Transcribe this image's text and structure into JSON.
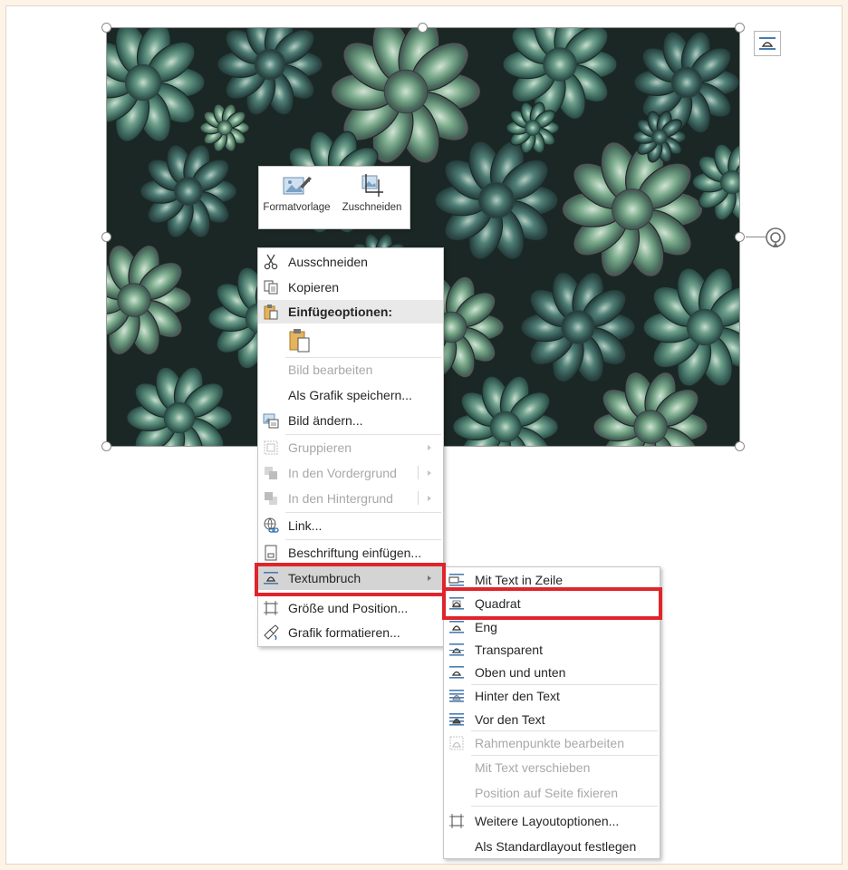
{
  "colors": {
    "highlight": "#e0242b",
    "background": "#fdf3e6"
  },
  "mini_toolbar": [
    {
      "label": "Formatvorlage",
      "icon": "style-icon"
    },
    {
      "label": "Zuschneiden",
      "icon": "crop-icon"
    }
  ],
  "context_menu": {
    "items": [
      {
        "label": "Ausschneiden",
        "icon": "scissors-icon",
        "enabled": true
      },
      {
        "label": "Kopieren",
        "icon": "copy-icon",
        "enabled": true
      },
      {
        "label": "Einfügeoptionen:",
        "icon": "paste-icon",
        "enabled": true
      },
      {
        "label": "Bild bearbeiten",
        "enabled": false
      },
      {
        "label": "Als Grafik speichern...",
        "enabled": true
      },
      {
        "label": "Bild ändern...",
        "icon": "change-picture-icon",
        "enabled": true
      },
      {
        "label": "Gruppieren",
        "icon": "group-icon",
        "enabled": false
      },
      {
        "label": "In den Vordergrund",
        "icon": "bring-forward-icon",
        "enabled": false
      },
      {
        "label": "In den Hintergrund",
        "icon": "send-backward-icon",
        "enabled": false
      },
      {
        "label": "Link...",
        "icon": "link-icon",
        "enabled": true
      },
      {
        "label": "Beschriftung einfügen...",
        "icon": "caption-icon",
        "enabled": true
      },
      {
        "label": "Textumbruch",
        "icon": "wrap-text-icon",
        "enabled": true,
        "highlighted": true
      },
      {
        "label": "Größe und Position...",
        "icon": "size-position-icon",
        "enabled": true
      },
      {
        "label": "Grafik formatieren...",
        "icon": "format-picture-icon",
        "enabled": true
      }
    ]
  },
  "wrap_submenu": {
    "items": [
      {
        "label": "Mit Text in Zeile",
        "icon": "inline-wrap-icon",
        "enabled": true
      },
      {
        "label": "Quadrat",
        "icon": "square-wrap-icon",
        "enabled": true,
        "highlighted": true
      },
      {
        "label": "Eng",
        "icon": "tight-wrap-icon",
        "enabled": true
      },
      {
        "label": "Transparent",
        "icon": "through-wrap-icon",
        "enabled": true
      },
      {
        "label": "Oben und unten",
        "icon": "top-bottom-wrap-icon",
        "enabled": true
      },
      {
        "label": "Hinter den Text",
        "icon": "behind-text-icon",
        "enabled": true
      },
      {
        "label": "Vor den Text",
        "icon": "in-front-text-icon",
        "enabled": true
      },
      {
        "label": "Rahmenpunkte bearbeiten",
        "icon": "edit-wrap-points-icon",
        "enabled": false
      },
      {
        "label": "Mit Text verschieben",
        "enabled": false
      },
      {
        "label": "Position auf Seite fixieren",
        "enabled": false
      },
      {
        "label": "Weitere Layoutoptionen...",
        "icon": "layout-options-icon",
        "enabled": true
      },
      {
        "label": "Als Standardlayout festlegen",
        "enabled": true
      }
    ]
  }
}
